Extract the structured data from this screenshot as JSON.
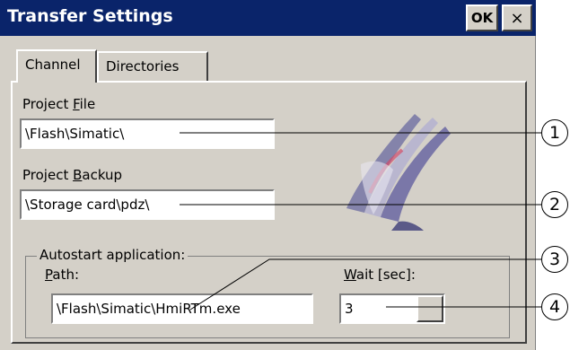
{
  "window": {
    "title": "Transfer Settings",
    "ok_label": "OK",
    "close_label": "×"
  },
  "tabs": [
    {
      "label": "Channel",
      "active": true
    },
    {
      "label": "Directories",
      "active": false
    }
  ],
  "project_file": {
    "label_prefix": "Project ",
    "label_accel": "F",
    "label_suffix": "ile",
    "value": "\\Flash\\Simatic\\"
  },
  "project_backup": {
    "label_prefix": "Project ",
    "label_accel": "B",
    "label_suffix": "ackup",
    "value": "\\Storage card\\pdz\\"
  },
  "autostart": {
    "group_label": "Autostart application:",
    "path_label_accel": "P",
    "path_label_suffix": "ath:",
    "path_value": "\\Flash\\Simatic\\HmiRTm.exe",
    "wait_label_accel": "W",
    "wait_label_suffix": "ait [sec]:",
    "wait_value": "3"
  },
  "callouts": [
    "1",
    "2",
    "3",
    "4"
  ],
  "colors": {
    "titlebar": "#0a246a",
    "dialog_bg": "#d4d0c8"
  }
}
